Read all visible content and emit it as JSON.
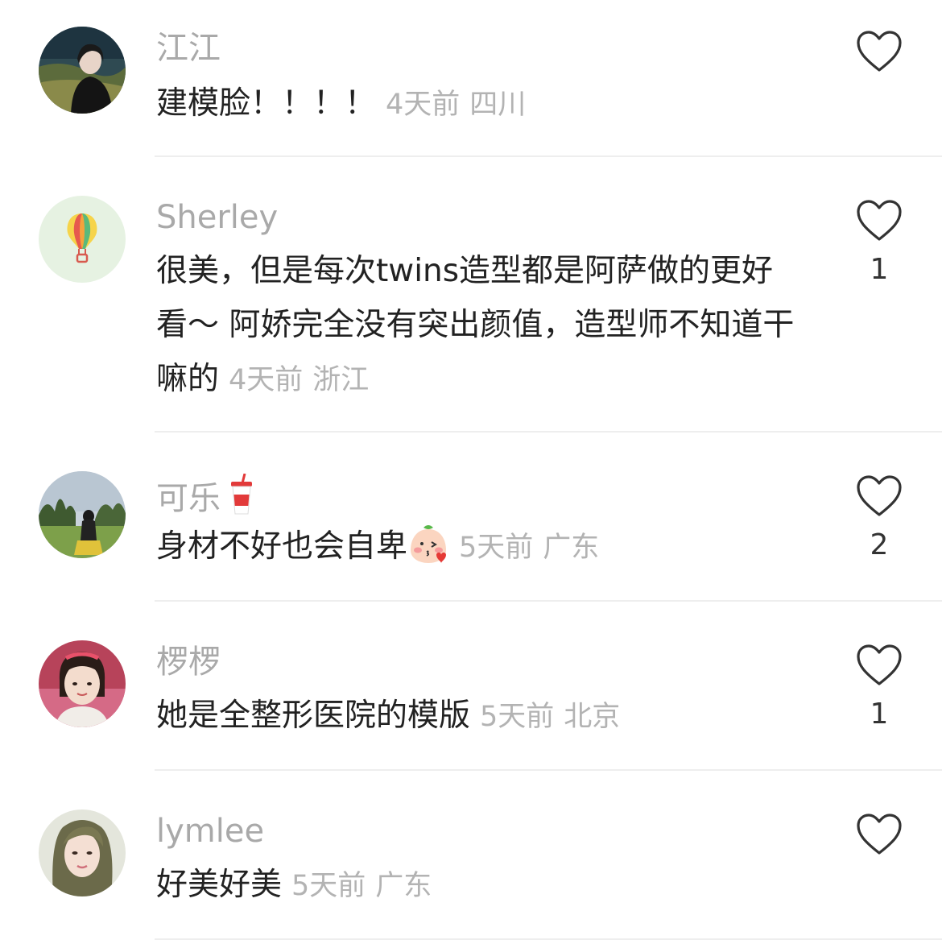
{
  "comments": [
    {
      "username": "江江",
      "text": "建模脸！！！！",
      "time": "4天前",
      "location": "四川",
      "likes": ""
    },
    {
      "username": "Sherley",
      "text": "很美，但是每次twins造型都是阿萨做的更好看～ 阿娇完全没有突出颜值，造型师不知道干嘛的",
      "time": "4天前",
      "location": "浙江",
      "likes": "1"
    },
    {
      "username": "可乐",
      "text": "身材不好也会自卑",
      "time": "5天前",
      "location": "广东",
      "likes": "2"
    },
    {
      "username": "椤椤",
      "text": "她是全整形医院的模版",
      "time": "5天前",
      "location": "北京",
      "likes": "1"
    },
    {
      "username": "lymlee",
      "text": "好美好美",
      "time": "5天前",
      "location": "广东",
      "likes": ""
    }
  ],
  "icons": {
    "like": "heart-outline-icon",
    "balloon": "hot-air-balloon-icon",
    "cup": "soda-cup-icon",
    "emoji": "blushing-kiss-emoji"
  },
  "colors": {
    "username": "#a9a9a9",
    "text": "#222222",
    "meta": "#b3b3b3",
    "divider": "#eeeeee"
  }
}
